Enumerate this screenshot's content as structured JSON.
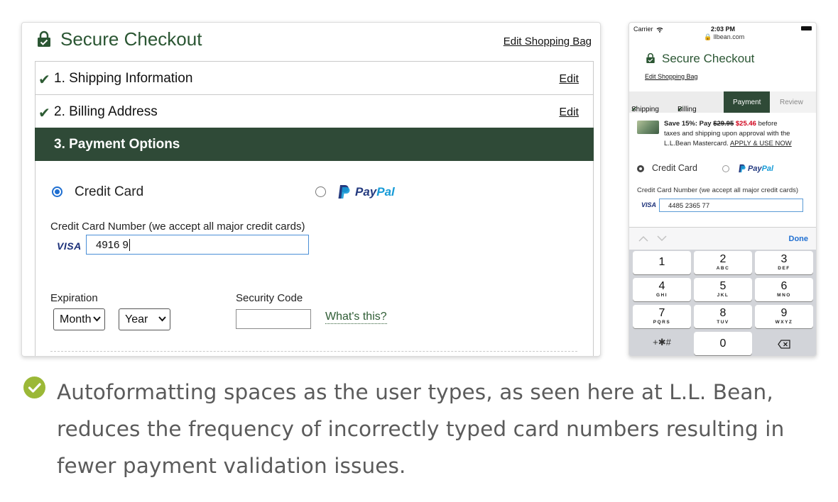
{
  "desktop": {
    "title": "Secure Checkout",
    "edit_bag": "Edit Shopping Bag",
    "steps": [
      {
        "label": "1. Shipping Information",
        "edit": "Edit"
      },
      {
        "label": "2. Billing Address",
        "edit": "Edit"
      }
    ],
    "payment_header": "3. Payment Options",
    "option_credit": "Credit Card",
    "option_paypal_pay": "Pay",
    "option_paypal_pal": "Pal",
    "cc_label": "Credit Card Number (we accept all major credit cards)",
    "visa": "VISA",
    "cc_value": "4916 9",
    "expiration_label": "Expiration",
    "month_value": "Month",
    "year_value": "Year",
    "security_label": "Security Code",
    "security_value": "",
    "whats_this": "What's this?"
  },
  "mobile": {
    "carrier": "Carrier",
    "time": "2:03 PM",
    "url": "llbean.com",
    "title": "Secure Checkout",
    "edit_bag": "Edit Shopping Bag",
    "tabs": [
      "Shipping",
      "Billing",
      "Payment",
      "Review"
    ],
    "active_tab": "Payment",
    "promo_prefix": "Save 15%: Pay ",
    "promo_old": "$29.95",
    "promo_new": "$25.46",
    "promo_line1_end": " before",
    "promo_line2": "taxes and shipping upon approval with the",
    "promo_line3": "L.L.Bean Mastercard. ",
    "promo_link": "APPLY & USE NOW",
    "option_credit": "Credit Card",
    "option_paypal_pay": "Pay",
    "option_paypal_pal": "Pal",
    "cc_label": "Credit Card Number (we accept all major credit cards)",
    "visa": "VISA",
    "cc_value": "4485 2365 77",
    "done": "Done",
    "keys": [
      {
        "n": "1",
        "s": ""
      },
      {
        "n": "2",
        "s": "ABC"
      },
      {
        "n": "3",
        "s": "DEF"
      },
      {
        "n": "4",
        "s": "GHI"
      },
      {
        "n": "5",
        "s": "JKL"
      },
      {
        "n": "6",
        "s": "MNO"
      },
      {
        "n": "7",
        "s": "PQRS"
      },
      {
        "n": "8",
        "s": "TUV"
      },
      {
        "n": "9",
        "s": "WXYZ"
      },
      {
        "n": "+✱#",
        "s": ""
      },
      {
        "n": "0",
        "s": ""
      }
    ]
  },
  "caption": "Autoformatting spaces as the user types, as seen here at L.L. Bean, reduces the frequency of incorrectly typed card numbers resulting in fewer payment validation issues.",
  "colors": {
    "brand_green": "#2b5633",
    "header_bar": "#2f4a37",
    "check_badge": "#9bb837",
    "link_blue": "#1f6fd1",
    "sale_red": "#d0021b"
  },
  "icons": [
    "lock-icon",
    "check-icon",
    "paypal-icon",
    "visa-icon",
    "chevron-down-icon",
    "wifi-icon",
    "battery-icon",
    "backspace-icon",
    "checkmark-badge-icon"
  ]
}
